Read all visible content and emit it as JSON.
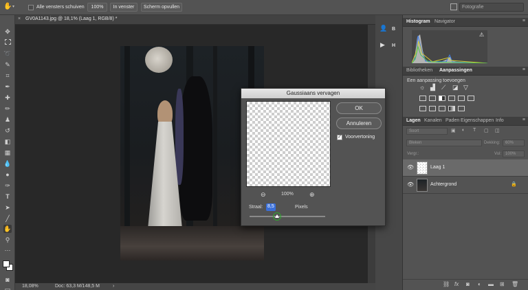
{
  "options_bar": {
    "all_windows_label": "Alle vensters schuiven",
    "zoom_100_label": "100%",
    "fit_window_label": "In venster",
    "fill_screen_label": "Scherm opvullen",
    "workspace_label": "Fotografie"
  },
  "document": {
    "tab_title": "GV0A1143.jpg @ 18,1% (Laag 1, RGB/8) *",
    "status_zoom": "18,08%",
    "status_doc": "Doc: 63,3 M/148,5 M"
  },
  "dialog": {
    "title": "Gaussiaans vervagen",
    "ok_label": "OK",
    "cancel_label": "Annuleren",
    "preview_label": "Voorvertoning",
    "preview_checked": true,
    "zoom_value": "100%",
    "radius_label": "Straal:",
    "radius_value": "8,5",
    "radius_unit": "Pixels",
    "slider_fraction": 0.36
  },
  "dock": {
    "item1_label": "B",
    "item2_label": "H"
  },
  "panels": {
    "histogram_tab": "Histogram",
    "navigator_tab": "Navigator",
    "libraries_tab": "Bibliotheken",
    "adjustments_tab": "Aanpassingen",
    "adjustments_hint": "Een aanpassing toevoegen",
    "layers_tabs": [
      "Lagen",
      "Kanalen",
      "Paden",
      "Eigenschappen",
      "Info"
    ],
    "kind_filter": "Soort",
    "blend_mode": "Bleken",
    "opacity_label": "Dekking:",
    "opacity_value": "60%",
    "lock_label": "Vergr.:",
    "fill_label": "Vul:",
    "fill_value": "100%",
    "layers": [
      {
        "name": "Laag 1",
        "selected": true
      },
      {
        "name": "Achtergrond",
        "selected": false,
        "locked": true
      }
    ]
  },
  "colors": {
    "accent_blue": "#3a6fd8",
    "panel_bg": "#535353",
    "canvas_bg": "#282828"
  }
}
